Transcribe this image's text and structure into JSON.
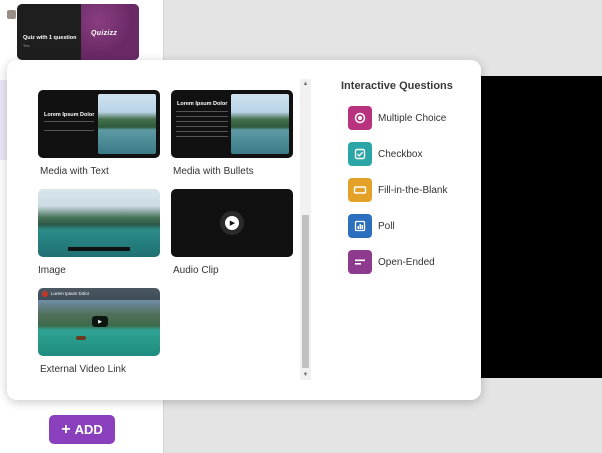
{
  "background": {
    "quiz_thumb": {
      "title": "Quiz with 1 question",
      "subtitle": "Text",
      "logo": "Quizizz"
    },
    "add_button": {
      "label": "ADD",
      "icon": "plus-icon"
    }
  },
  "popup": {
    "media_cards": [
      {
        "label": "Media with Text",
        "thumb_title": "Lorem Ipsum Dolor"
      },
      {
        "label": "Media with Bullets",
        "thumb_title": "Lorem Ipsum Dolor"
      },
      {
        "label": "Image"
      },
      {
        "label": "Audio Clip"
      },
      {
        "label": "External Video Link",
        "thumb_title": "Lorem Ipsum Dolor"
      }
    ],
    "interactive": {
      "title": "Interactive Questions",
      "items": [
        {
          "label": "Multiple Choice",
          "icon": "radio-icon",
          "color": "#b83280"
        },
        {
          "label": "Checkbox",
          "icon": "checkbox-icon",
          "color": "#2aa6a6"
        },
        {
          "label": "Fill-in-the-Blank",
          "icon": "blank-field-icon",
          "color": "#e3a127"
        },
        {
          "label": "Poll",
          "icon": "poll-icon",
          "color": "#2d6fbf"
        },
        {
          "label": "Open-Ended",
          "icon": "text-lines-icon",
          "color": "#8e3a8e"
        }
      ]
    }
  },
  "colors": {
    "accent": "#8a40bd"
  }
}
